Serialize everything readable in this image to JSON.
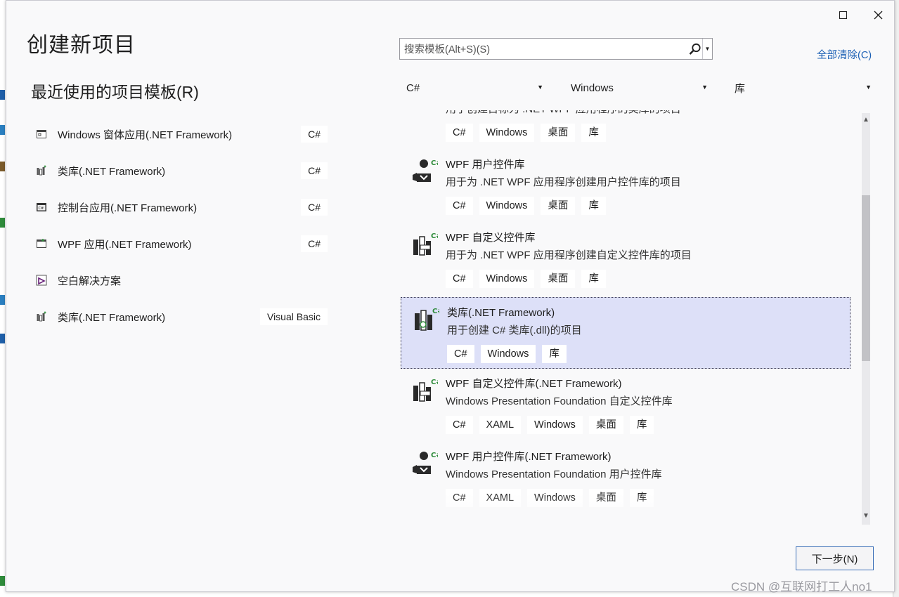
{
  "window": {
    "title": "创建新项目"
  },
  "recent": {
    "heading": "最近使用的项目模板(R)",
    "items": [
      {
        "label": "Windows 窗体应用(.NET Framework)",
        "tag": "C#",
        "icon": "winforms-icon"
      },
      {
        "label": "类库(.NET Framework)",
        "tag": "C#",
        "icon": "class-library-icon"
      },
      {
        "label": "控制台应用(.NET Framework)",
        "tag": "C#",
        "icon": "console-app-icon"
      },
      {
        "label": "WPF 应用(.NET Framework)",
        "tag": "C#",
        "icon": "wpf-app-icon"
      },
      {
        "label": "空白解决方案",
        "tag": "",
        "icon": "blank-solution-icon"
      },
      {
        "label": "类库(.NET Framework)",
        "tag": "Visual Basic",
        "icon": "class-library-vb-icon"
      }
    ]
  },
  "search": {
    "placeholder": "搜索模板(Alt+S)(S)",
    "value": ""
  },
  "clear_all": "全部清除(C)",
  "filters": {
    "language": "C#",
    "platform": "Windows",
    "project_type": "库"
  },
  "templates": [
    {
      "name": "",
      "desc": "用于创建目标为 .NET WPF 应用程序的类库的项目",
      "tags": [
        "C#",
        "Windows",
        "桌面",
        "库"
      ],
      "selected": false,
      "icon": "wpf-class-library-icon"
    },
    {
      "name": "WPF 用户控件库",
      "desc": "用于为 .NET WPF 应用程序创建用户控件库的项目",
      "tags": [
        "C#",
        "Windows",
        "桌面",
        "库"
      ],
      "selected": false,
      "icon": "user-control-library-icon"
    },
    {
      "name": "WPF 自定义控件库",
      "desc": "用于为 .NET WPF 应用程序创建自定义控件库的项目",
      "tags": [
        "C#",
        "Windows",
        "桌面",
        "库"
      ],
      "selected": false,
      "icon": "custom-control-library-icon"
    },
    {
      "name": "类库(.NET Framework)",
      "desc": "用于创建 C# 类库(.dll)的项目",
      "tags": [
        "C#",
        "Windows",
        "库"
      ],
      "selected": true,
      "icon": "class-library-icon"
    },
    {
      "name": "WPF 自定义控件库(.NET Framework)",
      "desc": "Windows Presentation Foundation 自定义控件库",
      "tags": [
        "C#",
        "XAML",
        "Windows",
        "桌面",
        "库"
      ],
      "selected": false,
      "icon": "custom-control-library-icon"
    },
    {
      "name": "WPF 用户控件库(.NET Framework)",
      "desc": "Windows Presentation Foundation 用户控件库",
      "tags": [
        "C#",
        "XAML",
        "Windows",
        "桌面",
        "库"
      ],
      "selected": false,
      "icon": "user-control-library-icon"
    }
  ],
  "next_button": "下一步(N)",
  "watermark": "CSDN @互联网打工人no1",
  "colors": {
    "selected_bg": "#dde0f8",
    "link": "#1a5fb4",
    "dialog_bg": "#f9f9fa",
    "csharp_green": "#2e8b3a"
  }
}
